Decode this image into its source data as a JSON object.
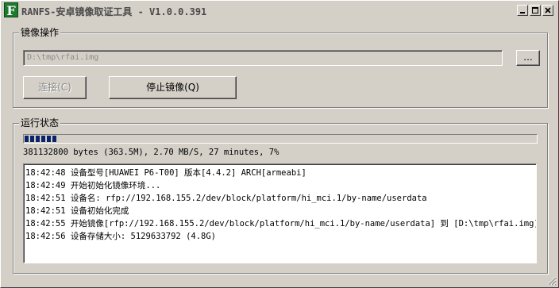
{
  "window": {
    "title": "RANFS-安卓镜像取证工具 - V1.0.0.391",
    "icon_letter": "F",
    "icon_color": "#1e7a2e"
  },
  "image_ops": {
    "label": "镜像操作",
    "path_value": "D:\\tmp\\rfai.img",
    "browse_label": "...",
    "connect_label": "连接(C)",
    "stop_label": "停止镜像(Q)"
  },
  "status": {
    "label": "运行状态",
    "progress_percent": 7,
    "progress_color": "#0a246a",
    "summary": "381132800 bytes (363.5M), 2.70 MB/S, 27 minutes, 7%",
    "log": [
      "18:42:48 设备型号[HUAWEI P6-T00] 版本[4.4.2] ARCH[armeabi]",
      "18:42:49 开始初始化镜像环境...",
      "18:42:51 设备名: rfp://192.168.155.2/dev/block/platform/hi_mci.1/by-name/userdata",
      "18:42:51 设备初始化完成",
      "18:42:55 开始镜像[rfp://192.168.155.2/dev/block/platform/hi_mci.1/by-name/userdata] 到 [D:\\tmp\\rfai.img]",
      "18:42:56 设备存储大小: 5129633792 (4.8G)"
    ]
  }
}
